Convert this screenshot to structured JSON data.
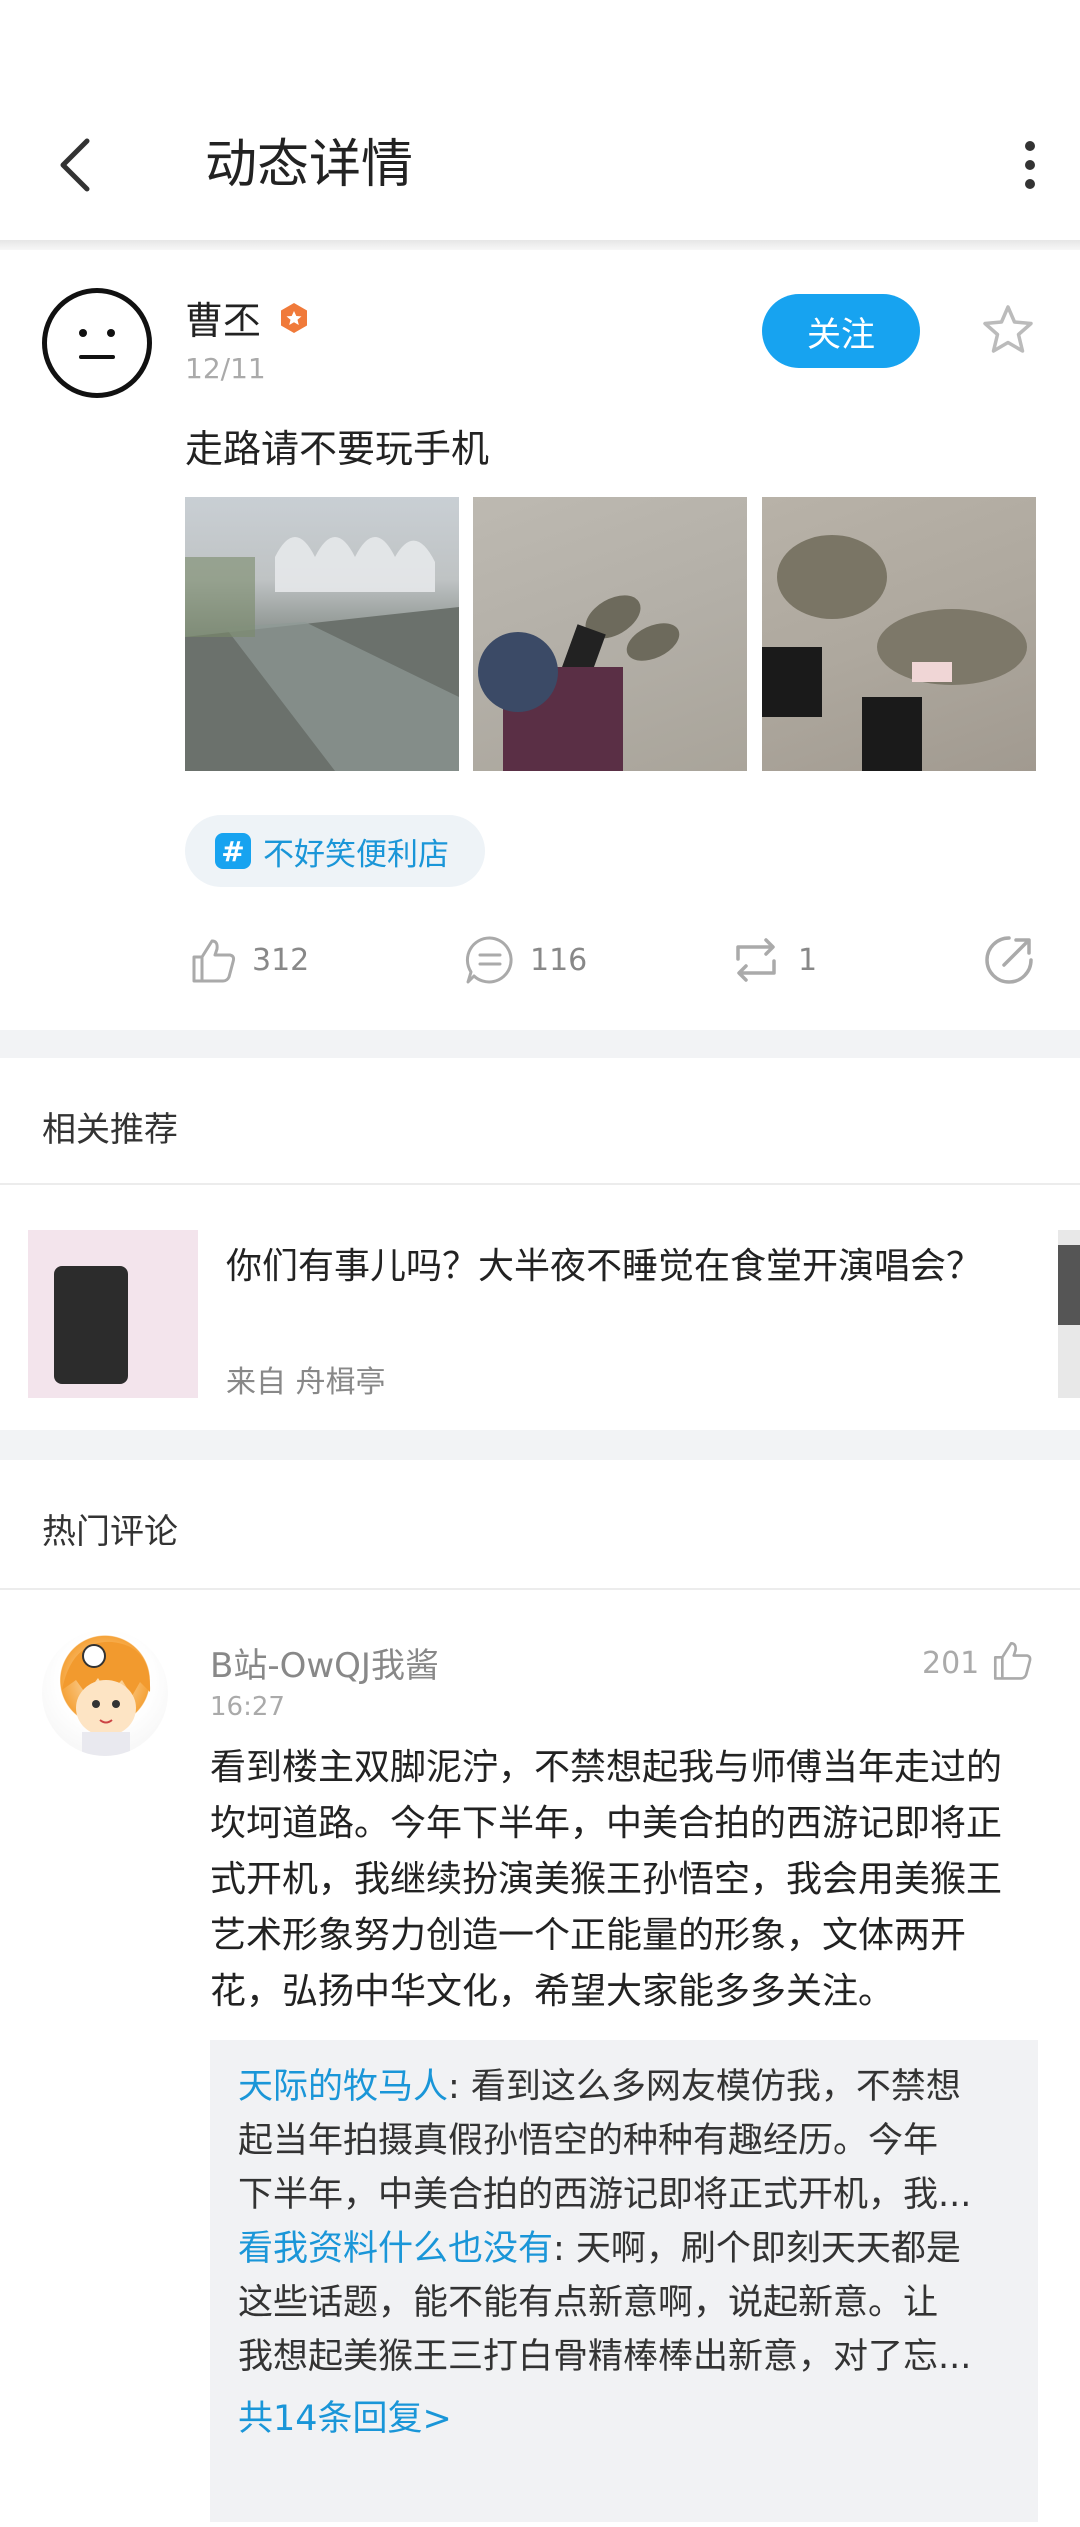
{
  "header": {
    "title": "动态详情"
  },
  "post": {
    "author": "曹丕",
    "date": "12/11",
    "follow_label": "关注",
    "text": "走路请不要玩手机",
    "topic": "不好笑便利店",
    "likes": "312",
    "comments": "116",
    "reposts": "1"
  },
  "recommend": {
    "section_title": "相关推荐",
    "item_title": "你们有事儿吗？大半夜不睡觉在食堂开演唱会？",
    "item_source": "来自 舟楫亭"
  },
  "hot_comments": {
    "section_title": "热门评论",
    "comment": {
      "user": "B站-OwQJ我酱",
      "time": "16:27",
      "likes": "201",
      "lines": [
        "看到楼主双脚泥泞，不禁想起我与师傅当年走过的",
        "坎坷道路。今年下半年，中美合拍的西游记即将正",
        "式开机，我继续扮演美猴王孙悟空，我会用美猴王",
        "艺术形象努力创造一个正能量的形象，文体两开",
        "花，弘扬中华文化，希望大家能多多关注。"
      ]
    },
    "replies": [
      {
        "user": "天际的牧马人",
        "first_line": ": 看到这么多网友模仿我，不禁想",
        "line2": "起当年拍摄真假孙悟空的种种有趣经历。今年",
        "line3": "下半年，中美合拍的西游记即将正式开机，我..."
      },
      {
        "user": "看我资料什么也没有",
        "first_line": ": 天啊，刷个即刻天天都是",
        "line2": "这些话题，能不能有点新意啊，说起新意。让",
        "line3": "我想起美猴王三打白骨精棒棒出新意，对了忘..."
      }
    ],
    "more_replies": "共14条回复>"
  },
  "colors": {
    "accent": "#17a3f0",
    "link": "#1a96d8",
    "background_band": "#f2f3f5"
  }
}
